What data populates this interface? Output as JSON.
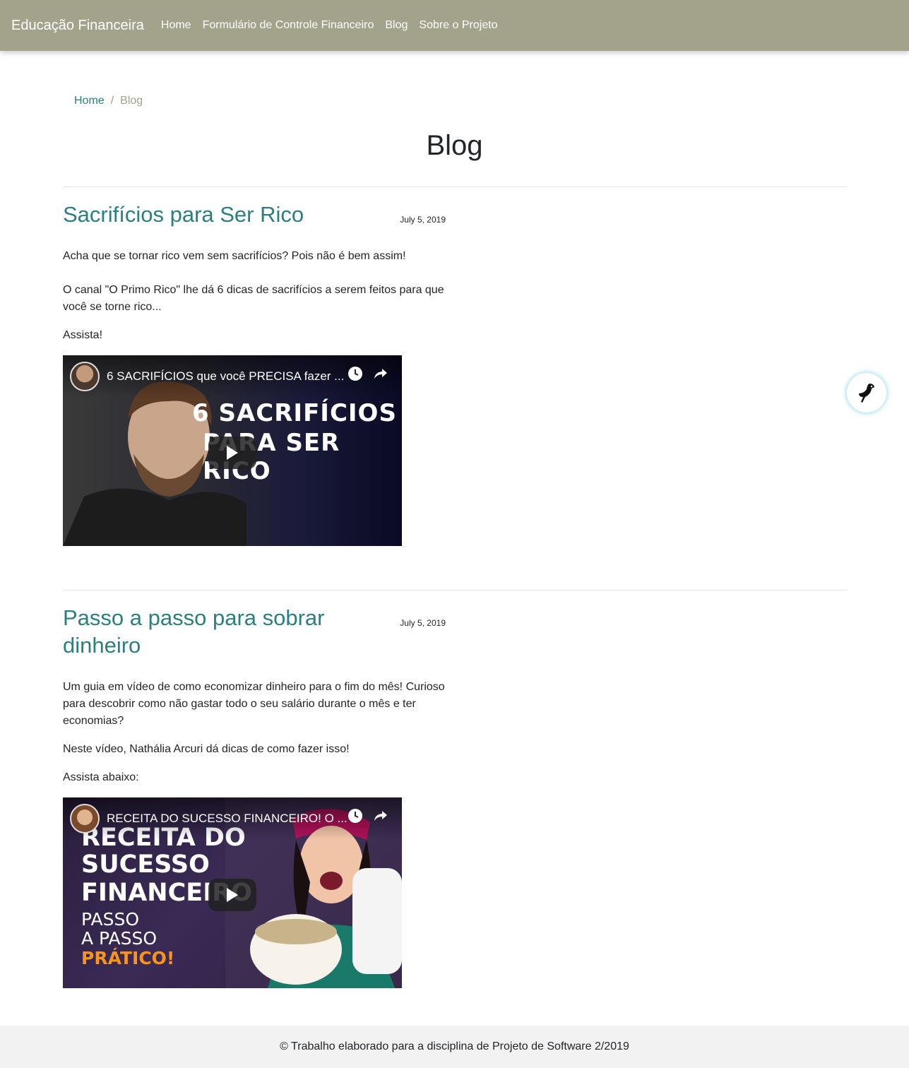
{
  "navbar": {
    "brand": "Educação Financeira",
    "links": [
      "Home",
      "Formulário de Controle Financeiro",
      "Blog",
      "Sobre o Projeto"
    ]
  },
  "breadcrumb": {
    "home": "Home",
    "separator": "/",
    "current": "Blog"
  },
  "page_title": "Blog",
  "posts": [
    {
      "title": "Sacrifícios para Ser Rico",
      "date": "July 5, 2019",
      "paragraphs": [
        "Acha que se tornar rico vem sem sacrifícios? Pois não é bem assim!",
        "O canal \"O Primo Rico\" lhe dá 6 dicas de sacrifícios a serem feitos para que você se torne rico...",
        "Assista!"
      ],
      "video": {
        "title": "6 SACRIFÍCIOS que você PRECISA fazer ...",
        "thumbnail_lines": [
          "6 SACRIFÍCIOS",
          "PARA SER RICO"
        ]
      }
    },
    {
      "title": "Passo a passo para sobrar dinheiro",
      "date": "July 5, 2019",
      "paragraphs": [
        "Um guia em vídeo de como economizar dinheiro para o fim do mês! Curioso para descobrir como não gastar todo o seu salário durante o mês e ter economias?",
        "Neste vídeo, Nathália Arcuri dá dicas de como fazer isso!",
        "Assista abaixo:"
      ],
      "video": {
        "title": "RECEITA DO SUCESSO FINANCEIRO! O ...",
        "thumbnail_lines": [
          "RECEITA DO",
          "SUCESSO",
          "FINANCEIRO",
          "PASSO",
          "A PASSO",
          "PRÁTICO!"
        ]
      }
    }
  ],
  "footer": {
    "text": "© Trabalho elaborado para a disciplina de Projeto de Software 2/2019"
  },
  "colors": {
    "navbar": "#a3a38c",
    "accent": "#2a7f80",
    "footer_bg": "#f2f2f2",
    "thumb_highlight": "#f7941d"
  },
  "icons": [
    "watch-later-icon",
    "share-icon",
    "play-icon",
    "bird-icon"
  ]
}
